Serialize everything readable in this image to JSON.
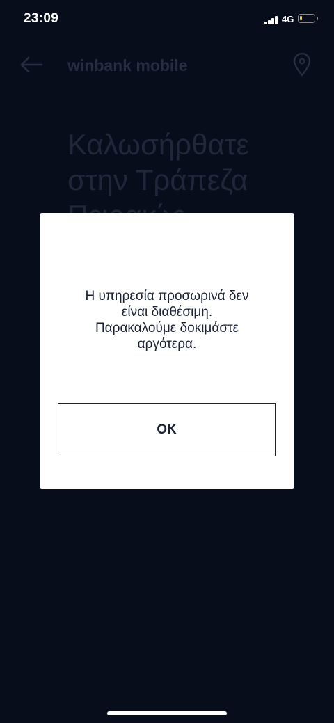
{
  "status_bar": {
    "time": "23:09",
    "network": "4G",
    "battery_level": 0.15,
    "battery_color": "#f2d23a"
  },
  "header": {
    "back_icon": "arrow-left-icon",
    "title": "winbank mobile",
    "location_icon": "map-pin-icon"
  },
  "background": {
    "welcome_text": "Καλωσήρθατε\nστην Τράπεζα\nΠειραιώς"
  },
  "dialog": {
    "message": "Η υπηρεσία προσωρινά δεν\nείναι διαθέσιμη.\nΠαρακαλούμε δοκιμάστε\nαργότερα.",
    "ok_label": "OK"
  },
  "colors": {
    "background": "#080d1c",
    "dialog": "#ffffff",
    "text_dark": "#1b2236"
  }
}
